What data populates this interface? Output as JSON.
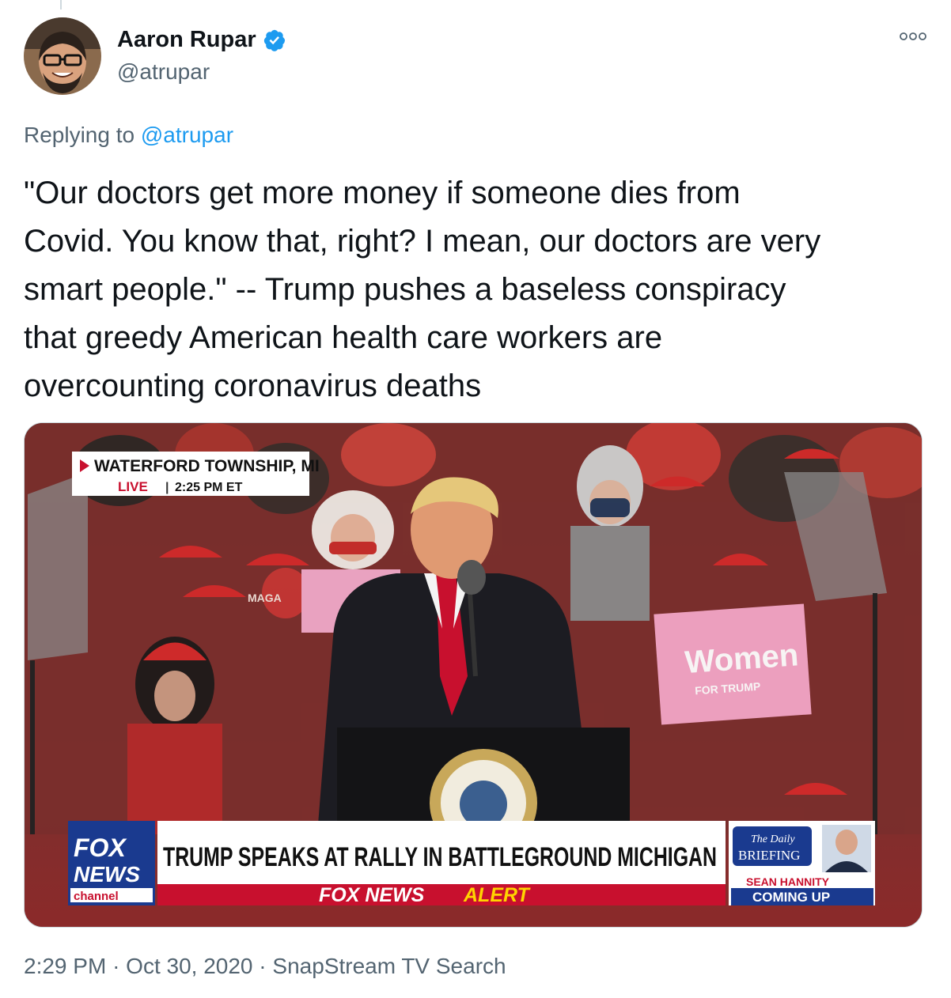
{
  "author": {
    "display_name": "Aaron Rupar",
    "handle": "@atrupar",
    "verified": true
  },
  "reply": {
    "prefix": "Replying to",
    "mention": "@atrupar"
  },
  "tweet": {
    "text": "\"Our doctors get more money if someone dies from\nCovid. You know that, right? I mean, our doctors are very\nsmart people.\" -- Trump pushes a baseless conspiracy\nthat greedy American health care workers are\novercounting coronavirus deaths"
  },
  "media": {
    "location": "WATERFORD TOWNSHIP, MI",
    "live_label": "LIVE",
    "live_time": "2:25 PM ET",
    "network_line1": "FOX",
    "network_line2": "NEWS",
    "network_line3": "channel",
    "headline": "TRUMP SPEAKS AT RALLY IN BATTLEGROUND MICHIGAN",
    "alert_left": "FOX NEWS",
    "alert_right": "ALERT",
    "promo_title_line1": "The Daily",
    "promo_title_line2": "BRIEFING",
    "promo_host": "SEAN HANNITY",
    "promo_status": "COMING UP",
    "sign_text": "Women",
    "sign_sub": "FOR TRUMP",
    "hat_text": "MAGA"
  },
  "footer": {
    "time": "2:29 PM",
    "separator": "·",
    "date": "Oct 30, 2020",
    "source": "SnapStream TV Search"
  },
  "colors": {
    "text": "#0f1419",
    "secondary": "#536471",
    "link": "#1d9bf0",
    "fox_blue": "#1a3a8f",
    "fox_red": "#d0152b"
  }
}
